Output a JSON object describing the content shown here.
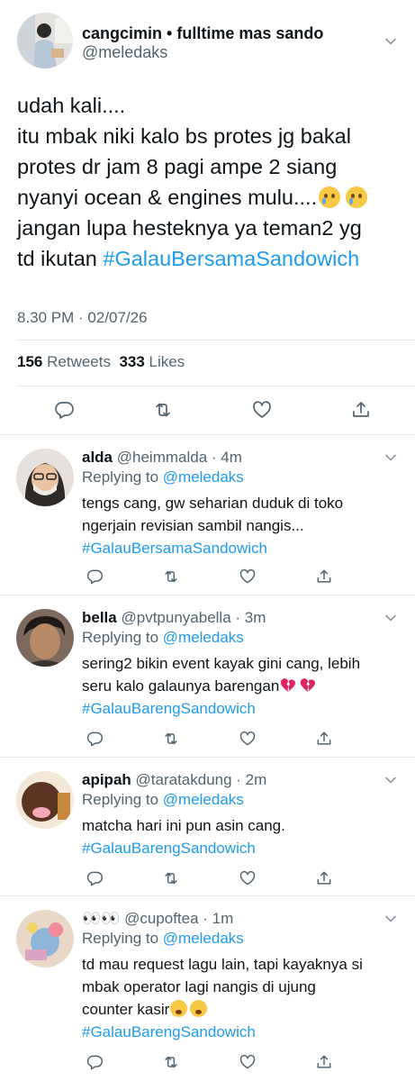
{
  "main": {
    "display_name": "cangcimin • fulltime mas sando",
    "handle": "@meledaks",
    "body_lines": [
      "udah kali....",
      "itu mbak niki kalo bs protes jg bakal",
      "protes dr jam 8 pagi ampe 2 siang",
      "nyanyi ocean & engines mulu....",
      "jangan lupa hesteknya ya teman2 yg",
      "td ikutan "
    ],
    "hashtag": "#GalauBersamaSandowich",
    "timestamp": "8.30 PM · 02/07/26",
    "retweets_count": "156",
    "retweets_label": "Retweets",
    "likes_count": "333",
    "likes_label": "Likes"
  },
  "replies": [
    {
      "name": "alda",
      "handle_time": "@heimmalda · 4m",
      "replying_label": "Replying to ",
      "replying_to": "@meledaks",
      "lines": [
        "tengs cang, gw seharian duduk di toko",
        "ngerjain revisian sambil nangis..."
      ],
      "hashtag": "#GalauBersamaSandowich"
    },
    {
      "name": "bella",
      "handle_time": "@pvtpunyabella · 3m",
      "replying_label": "Replying to ",
      "replying_to": "@meledaks",
      "lines": [
        "sering2 bikin event kayak gini cang, lebih",
        "seru kalo galaunya barengan"
      ],
      "hashtag": "#GalauBarengSandowich"
    },
    {
      "name": "apipah",
      "handle_time": "@taratakdung · 2m",
      "replying_label": "Replying to ",
      "replying_to": "@meledaks",
      "lines": [
        "matcha hari ini pun asin cang."
      ],
      "hashtag": "#GalauBarengSandowich"
    },
    {
      "name": "👀👀",
      "handle_time": "@cupoftea · 1m",
      "replying_label": "Replying to ",
      "replying_to": "@meledaks",
      "lines": [
        "td mau request lagu lain, tapi kayaknya si",
        "mbak operator lagi nangis di ujung",
        "counter kasir"
      ],
      "hashtag": "#GalauBarengSandowich"
    }
  ],
  "colors": {
    "accent": "#1d9bf0",
    "secondary_text": "#536471",
    "divider": "#e6e9ec"
  },
  "icons": [
    "chevron-down-icon",
    "reply-icon",
    "retweet-icon",
    "like-icon",
    "share-icon",
    "crying-emoji",
    "broken-heart-emoji",
    "sobbing-emoji"
  ]
}
